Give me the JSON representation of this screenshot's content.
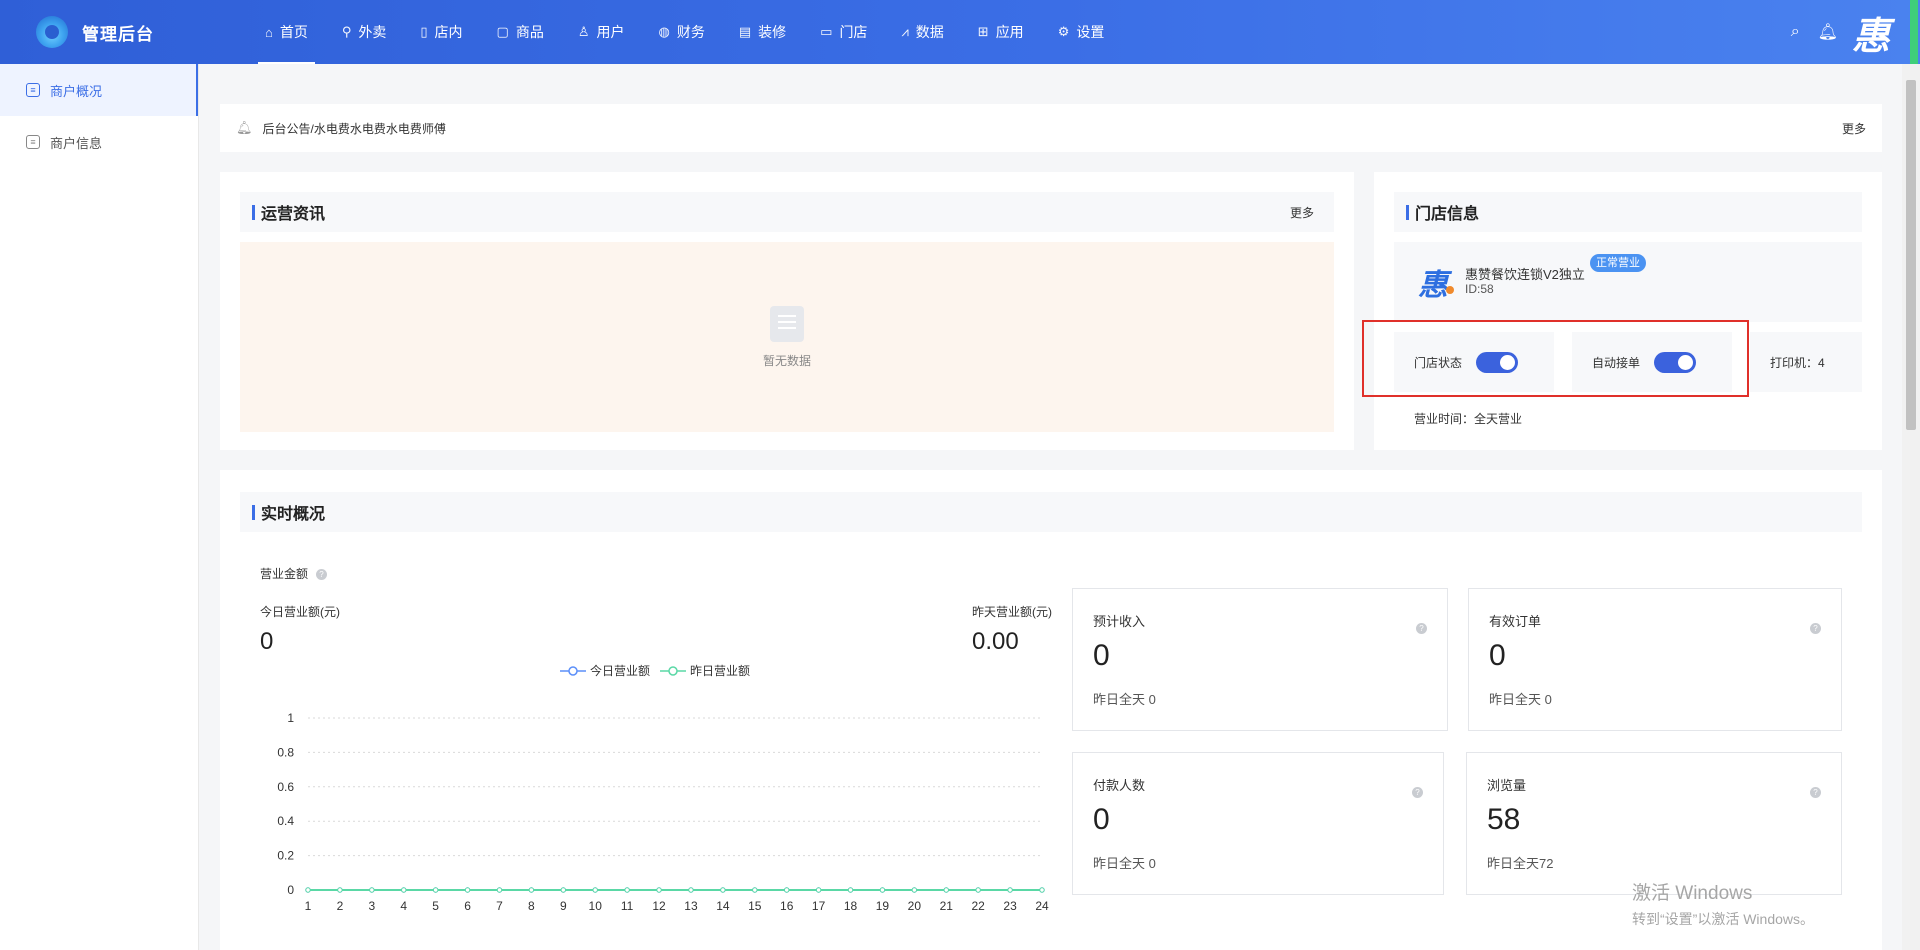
{
  "header": {
    "brand_title": "管理后台",
    "nav": [
      {
        "label": "首页",
        "icon": "home-icon"
      },
      {
        "label": "外卖",
        "icon": "bike-icon"
      },
      {
        "label": "店内",
        "icon": "door-icon"
      },
      {
        "label": "商品",
        "icon": "bag-icon"
      },
      {
        "label": "用户",
        "icon": "user-icon"
      },
      {
        "label": "财务",
        "icon": "money-bag-icon"
      },
      {
        "label": "装修",
        "icon": "shop-front-icon"
      },
      {
        "label": "门店",
        "icon": "store-icon"
      },
      {
        "label": "数据",
        "icon": "chart-icon"
      },
      {
        "label": "应用",
        "icon": "apps-grid-icon"
      },
      {
        "label": "设置",
        "icon": "gear-icon"
      }
    ],
    "logo_char": "惠"
  },
  "sidebar": {
    "items": [
      {
        "label": "商户概况",
        "active": true
      },
      {
        "label": "商户信息",
        "active": false
      }
    ]
  },
  "notice": {
    "text": "后台公告/水电费水电费水电费师傅",
    "more": "更多"
  },
  "operations": {
    "title": "运营资讯",
    "more": "更多",
    "empty_text": "暂无数据"
  },
  "store": {
    "title": "门店信息",
    "logo_char": "惠",
    "name": "惠赞餐饮连锁V2独立",
    "id_text": "ID:58",
    "status_badge": "正常营业",
    "status_label": "门店状态",
    "auto_accept_label": "自动接单",
    "printer_text": "打印机：4",
    "hours_text": "营业时间：全天营业",
    "store_status_on": true,
    "auto_accept_on": true
  },
  "realtime": {
    "title": "实时概况",
    "revenue_label": "营业金额",
    "today_label": "今日营业额(元)",
    "today_value": "0",
    "yesterday_label": "昨天营业额(元)",
    "yesterday_value": "0.00",
    "stats": [
      {
        "title": "预计收入",
        "value": "0",
        "sub": "昨日全天 0"
      },
      {
        "title": "有效订单",
        "value": "0",
        "sub": "昨日全天 0"
      },
      {
        "title": "付款人数",
        "value": "0",
        "sub": "昨日全天 0"
      },
      {
        "title": "浏览量",
        "value": "58",
        "sub": "昨日全天72"
      }
    ]
  },
  "chart_data": {
    "type": "line",
    "x": [
      "1",
      "2",
      "3",
      "4",
      "5",
      "6",
      "7",
      "8",
      "9",
      "10",
      "11",
      "12",
      "13",
      "14",
      "15",
      "16",
      "17",
      "18",
      "19",
      "20",
      "21",
      "22",
      "23",
      "24"
    ],
    "series": [
      {
        "name": "今日营业额",
        "color": "#5b8ff9",
        "values": [
          0,
          0,
          0,
          0,
          0,
          0,
          0,
          0,
          0,
          0,
          0,
          0,
          0,
          0,
          0,
          0,
          0,
          0,
          0,
          0,
          0,
          0,
          0,
          0
        ]
      },
      {
        "name": "昨日营业额",
        "color": "#5ad8a6",
        "values": [
          0,
          0,
          0,
          0,
          0,
          0,
          0,
          0,
          0,
          0,
          0,
          0,
          0,
          0,
          0,
          0,
          0,
          0,
          0,
          0,
          0,
          0,
          0,
          0
        ]
      }
    ],
    "yticks": [
      "0",
      "0.2",
      "0.4",
      "0.6",
      "0.8",
      "1"
    ],
    "ylim": [
      0,
      1
    ],
    "grid": true,
    "legend": "top-center"
  },
  "watermark": {
    "line1": "激活 Windows",
    "line2": "转到“设置”以激活 Windows。"
  }
}
